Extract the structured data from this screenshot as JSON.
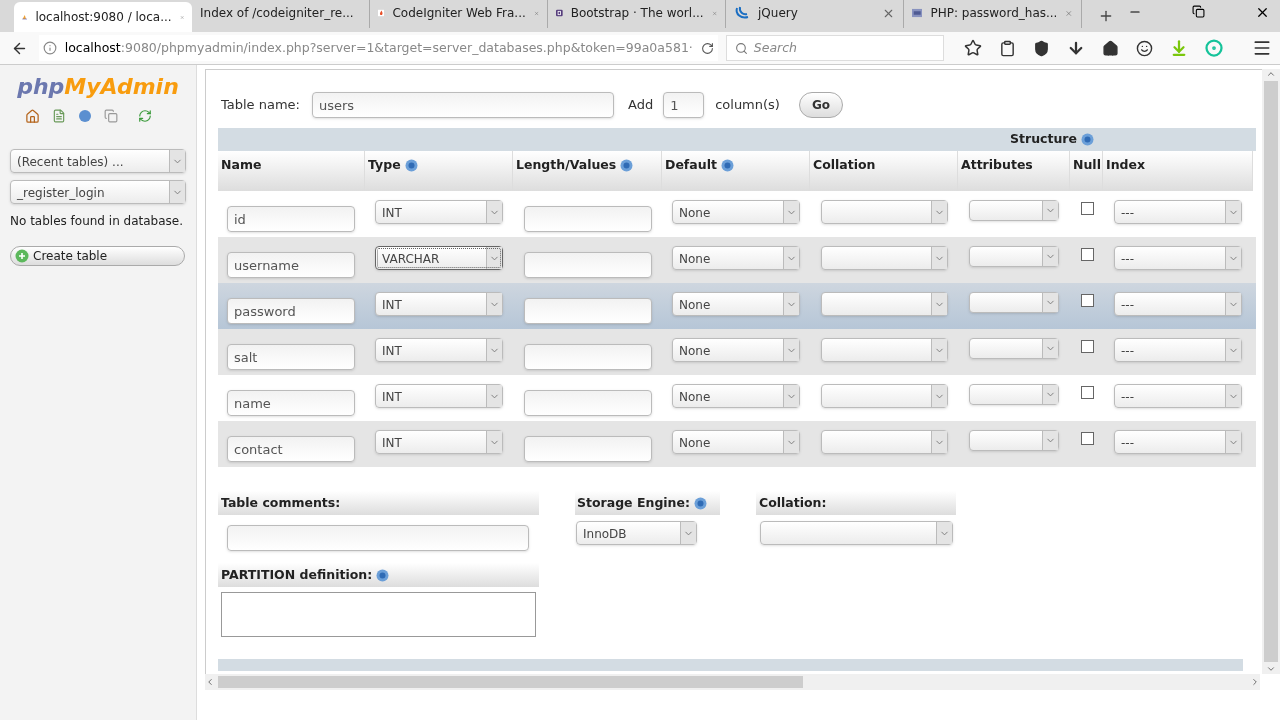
{
  "browser": {
    "tabs": [
      {
        "title": "localhost:9080 / loca...",
        "selected": true
      },
      {
        "title": "Index of /codeigniter_re...",
        "selected": false
      },
      {
        "title": "CodeIgniter Web Fra...",
        "selected": false
      },
      {
        "title": "Bootstrap · The worl...",
        "selected": false
      },
      {
        "title": "jQuery",
        "selected": false
      },
      {
        "title": "PHP: password_has...",
        "selected": false
      }
    ],
    "address": {
      "host": "localhost",
      "rest": ":9080/phpmyadmin/index.php?server=1&target=server_databases.php&token=99a0a581·"
    },
    "search": {
      "placeholder": "Search"
    }
  },
  "sidebar": {
    "logo": {
      "first": "php",
      "second": "MyAdmin"
    },
    "recent_tables": "(Recent tables) ...",
    "database": "_register_login",
    "message": "No tables found in database.",
    "create_button": "Create table"
  },
  "form": {
    "table_name_label": "Table name:",
    "table_name": "users",
    "add_label": "Add",
    "add_count": "1",
    "add_unit": "column(s)",
    "go_button": "Go",
    "structure_label": "Structure",
    "columns": [
      {
        "label": "Name",
        "help": false
      },
      {
        "label": "Type",
        "help": true
      },
      {
        "label": "Length/Values",
        "help": true
      },
      {
        "label": "Default",
        "help": true
      },
      {
        "label": "Collation",
        "help": false
      },
      {
        "label": "Attributes",
        "help": false
      },
      {
        "label": "Null",
        "help": false
      },
      {
        "label": "Index",
        "help": false
      }
    ],
    "rows": [
      {
        "name": "id",
        "type": "INT",
        "default": "None",
        "index": "---",
        "null": false,
        "highlighted": false,
        "type_focused": false
      },
      {
        "name": "username",
        "type": "VARCHAR",
        "default": "None",
        "index": "---",
        "null": false,
        "highlighted": false,
        "type_focused": true
      },
      {
        "name": "password",
        "type": "INT",
        "default": "None",
        "index": "---",
        "null": false,
        "highlighted": true,
        "type_focused": false
      },
      {
        "name": "salt",
        "type": "INT",
        "default": "None",
        "index": "---",
        "null": false,
        "highlighted": false,
        "type_focused": false
      },
      {
        "name": "name",
        "type": "INT",
        "default": "None",
        "index": "---",
        "null": false,
        "highlighted": false,
        "type_focused": false
      },
      {
        "name": "contact",
        "type": "INT",
        "default": "None",
        "index": "---",
        "null": false,
        "highlighted": false,
        "type_focused": false
      }
    ],
    "table_comments_label": "Table comments:",
    "storage_engine_label": "Storage Engine:",
    "storage_engine": "InnoDB",
    "collation_label": "Collation:",
    "partition_label": "PARTITION definition:"
  }
}
